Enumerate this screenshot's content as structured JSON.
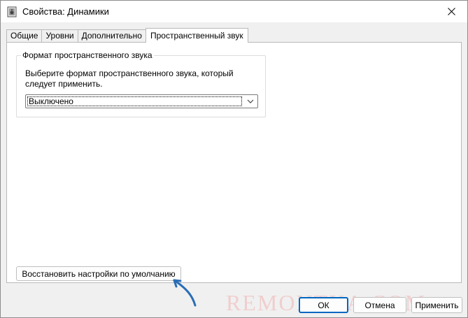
{
  "window": {
    "title": "Свойства: Динамики",
    "icon": "speaker-icon"
  },
  "tabs": [
    {
      "label": "Общие",
      "active": false
    },
    {
      "label": "Уровни",
      "active": false
    },
    {
      "label": "Дополнительно",
      "active": false
    },
    {
      "label": "Пространственный звук",
      "active": true
    }
  ],
  "group": {
    "label": "Формат пространственного звука",
    "description": "Выберите формат пространственного звука, который следует применить.",
    "select_value": "Выключено"
  },
  "reset_button": "Восстановить настройки по умолчанию",
  "buttons": {
    "ok": "ОК",
    "cancel": "Отмена",
    "apply": "Применить"
  },
  "watermark": "REMONTKA.COM",
  "colors": {
    "accent": "#0067c0",
    "annotation_arrow": "#2a6db5"
  }
}
